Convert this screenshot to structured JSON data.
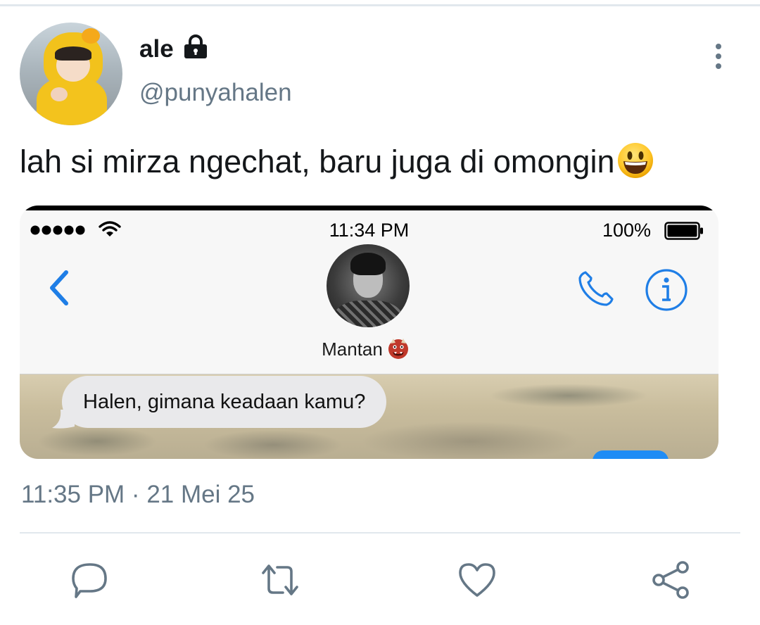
{
  "tweet": {
    "display_name": "ale",
    "handle": "@punyahalen",
    "text": "lah si mirza ngechat, baru juga di omongin",
    "timestamp": "11:35 PM · 21 Mei 25",
    "icons": {
      "lock": "lock-icon",
      "more": "more-vertical-icon",
      "emoji": "grinning-face-emoji"
    }
  },
  "media": {
    "status_bar": {
      "time": "11:34 PM",
      "battery": "100%"
    },
    "contact": {
      "name": "Mantan",
      "emoji": "ogre-emoji"
    },
    "message": {
      "text": "Halen, gimana keadaan kamu?"
    },
    "colors": {
      "ios_blue": "#1f7ee6",
      "bubble_gray": "#e9e9eb"
    }
  },
  "actions": [
    {
      "name": "reply",
      "icon": "reply-icon"
    },
    {
      "name": "retweet",
      "icon": "retweet-icon"
    },
    {
      "name": "like",
      "icon": "heart-icon"
    },
    {
      "name": "share",
      "icon": "share-icon"
    }
  ],
  "colors": {
    "secondary_text": "#657786",
    "primary_text": "#14171a",
    "divider": "#e1e8ed"
  }
}
